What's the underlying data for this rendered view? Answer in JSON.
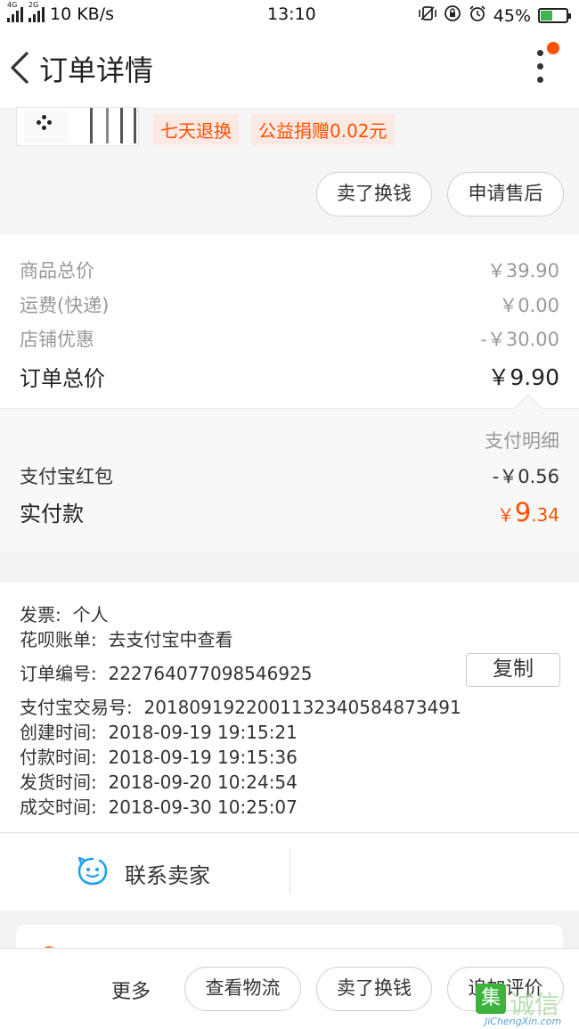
{
  "status_bar": {
    "network_left": "4G",
    "network_right": "2G",
    "speed": "10 KB/s",
    "time": "13:10",
    "battery": "45%",
    "battery_level": 0.45,
    "icons": [
      "vibrate-icon",
      "rotation-lock-icon",
      "alarm-icon"
    ]
  },
  "header": {
    "title": "订单详情",
    "back_icon": "chevron-left-icon",
    "more_icon": "more-vertical-icon"
  },
  "product": {
    "badges": [
      "七天退换",
      "公益捐赠0.02元"
    ],
    "actions": [
      "卖了换钱",
      "申请售后"
    ]
  },
  "price_summary": {
    "rows": [
      {
        "label": "商品总价",
        "value": "￥39.90"
      },
      {
        "label": "运费(快递)",
        "value": "￥0.00"
      },
      {
        "label": "店铺优惠",
        "value": "-￥30.00"
      }
    ],
    "total_label": "订单总价",
    "total_value": "￥9.90"
  },
  "payment": {
    "detail_link": "支付明细",
    "redpacket_label": "支付宝红包",
    "redpacket_value": "-￥0.56",
    "paid_label": "实付款",
    "paid_currency": "￥",
    "paid_int": "9",
    "paid_dec": ".34"
  },
  "order_info": {
    "invoice_label": "发票:",
    "invoice_value": "个人",
    "huabei_label": "花呗账单:",
    "huabei_value": "去支付宝中查看",
    "order_no_label": "订单编号:",
    "order_no": "222764077098546925",
    "copy_label": "复制",
    "alipay_no_label": "支付宝交易号:",
    "alipay_no": "2018091922001132340584873491",
    "created_label": "创建时间:",
    "created": "2018-09-19 19:15:21",
    "paid_time_label": "付款时间:",
    "paid_time": "2018-09-19 19:15:36",
    "shipped_label": "发货时间:",
    "shipped": "2018-09-20 10:24:54",
    "completed_label": "成交时间:",
    "completed": "2018-09-30 10:25:07"
  },
  "contact": {
    "label": "联系卖家",
    "icon": "wangwang-chat-icon"
  },
  "bottom_bar": {
    "more": "更多",
    "buttons": [
      "查看物流",
      "卖了换钱",
      "追加评价"
    ]
  },
  "watermark": {
    "cn": "诚信",
    "en": "JiChengXin.com",
    "logo_char": "集"
  },
  "colors": {
    "accent": "#ff5000",
    "chat_icon": "#1ea1f2",
    "watermark_green": "#3db33e"
  }
}
